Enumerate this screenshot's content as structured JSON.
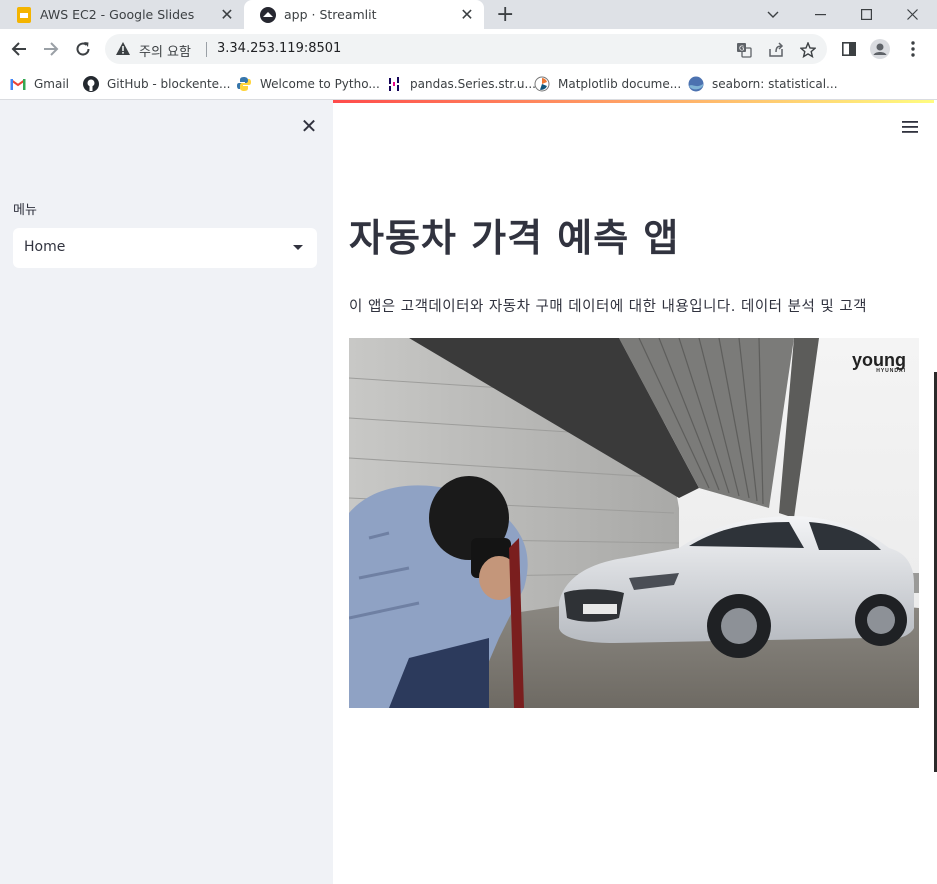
{
  "browser": {
    "tabs": [
      {
        "title": "AWS EC2 - Google Slides",
        "icon": "google-slides-icon",
        "active": false
      },
      {
        "title": "app · Streamlit",
        "icon": "streamlit-icon",
        "active": true
      }
    ],
    "address_bar": {
      "warning_text": "주의 요함",
      "url": "3.34.253.119:8501"
    },
    "bookmarks": [
      {
        "label": "Gmail",
        "icon": "gmail-icon"
      },
      {
        "label": "GitHub - blockente...",
        "icon": "github-icon"
      },
      {
        "label": "Welcome to Pytho...",
        "icon": "python-icon"
      },
      {
        "label": "pandas.Series.str.u...",
        "icon": "pandas-icon"
      },
      {
        "label": "Matplotlib docume...",
        "icon": "matplotlib-icon"
      },
      {
        "label": "seaborn: statistical...",
        "icon": "seaborn-icon"
      }
    ]
  },
  "sidebar": {
    "menu_label": "메뉴",
    "menu_selected": "Home"
  },
  "main": {
    "title": "자동차 가격 예측 앱",
    "description": "이 앱은 고객데이터와 자동차 구매 데이터에 대한 내용입니다. 데이터 분석 및 고객",
    "hero_logo": "young",
    "hero_logo_sub": "HYUNDAI"
  },
  "colors": {
    "sidebar_bg": "#f0f2f6",
    "accent_gradient_start": "#ff4b4b",
    "accent_gradient_end": "#fffd80",
    "text": "#31333f"
  }
}
